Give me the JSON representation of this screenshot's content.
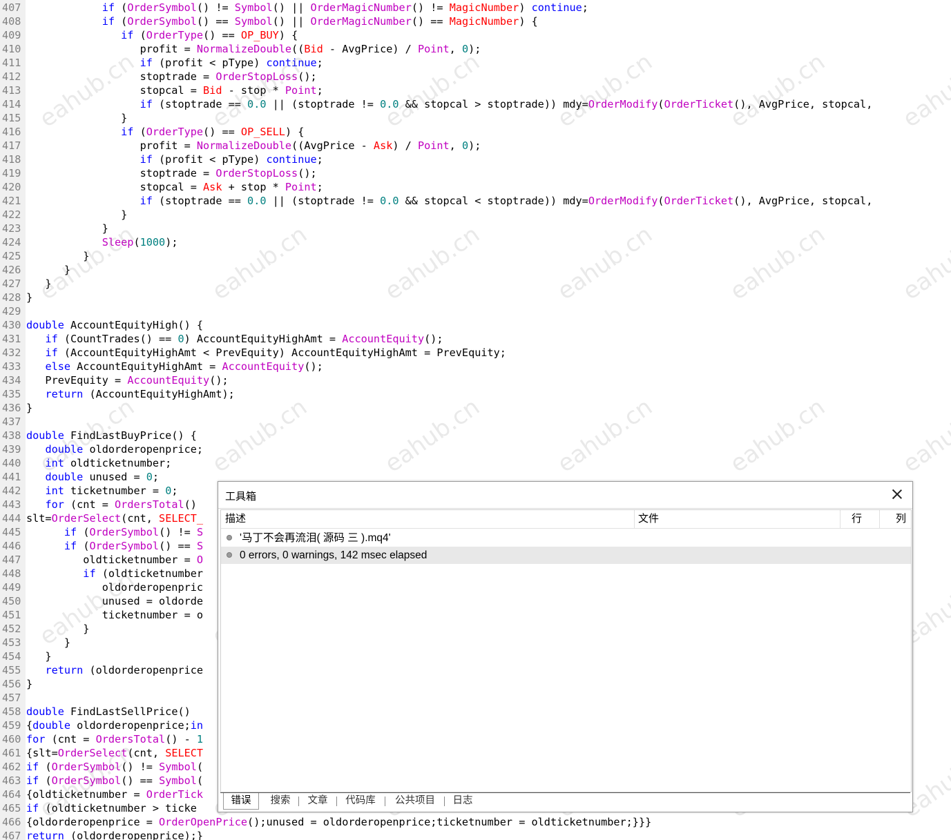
{
  "editor": {
    "lines": [
      {
        "n": "407",
        "c": [
          [
            "            ",
            ""
          ],
          [
            "if",
            "kw"
          ],
          [
            " (",
            ""
          ],
          [
            "OrderSymbol",
            "fn"
          ],
          [
            "() != ",
            ""
          ],
          [
            "Symbol",
            "fn"
          ],
          [
            "() || ",
            ""
          ],
          [
            "OrderMagicNumber",
            "fn"
          ],
          [
            "() != ",
            ""
          ],
          [
            "MagicNumber",
            "cn"
          ],
          [
            ") ",
            ""
          ],
          [
            "continue",
            "kw"
          ],
          [
            ";",
            ""
          ]
        ]
      },
      {
        "n": "408",
        "c": [
          [
            "            ",
            ""
          ],
          [
            "if",
            "kw"
          ],
          [
            " (",
            ""
          ],
          [
            "OrderSymbol",
            "fn"
          ],
          [
            "() == ",
            ""
          ],
          [
            "Symbol",
            "fn"
          ],
          [
            "() || ",
            ""
          ],
          [
            "OrderMagicNumber",
            "fn"
          ],
          [
            "() == ",
            ""
          ],
          [
            "MagicNumber",
            "cn"
          ],
          [
            ") {",
            ""
          ]
        ]
      },
      {
        "n": "409",
        "c": [
          [
            "               ",
            ""
          ],
          [
            "if",
            "kw"
          ],
          [
            " (",
            ""
          ],
          [
            "OrderType",
            "fn"
          ],
          [
            "() == ",
            ""
          ],
          [
            "OP_BUY",
            "cn"
          ],
          [
            ") {",
            ""
          ]
        ]
      },
      {
        "n": "410",
        "c": [
          [
            "                  profit = ",
            ""
          ],
          [
            "NormalizeDouble",
            "fn"
          ],
          [
            "((",
            ""
          ],
          [
            "Bid",
            "cn"
          ],
          [
            " - AvgPrice) / ",
            ""
          ],
          [
            "Point",
            "fn"
          ],
          [
            ", ",
            ""
          ],
          [
            "0",
            "nm"
          ],
          [
            ");",
            ""
          ]
        ]
      },
      {
        "n": "411",
        "c": [
          [
            "                  ",
            ""
          ],
          [
            "if",
            "kw"
          ],
          [
            " (profit < pType) ",
            ""
          ],
          [
            "continue",
            "kw"
          ],
          [
            ";",
            ""
          ]
        ]
      },
      {
        "n": "412",
        "c": [
          [
            "                  stoptrade = ",
            ""
          ],
          [
            "OrderStopLoss",
            "fn"
          ],
          [
            "();",
            ""
          ]
        ]
      },
      {
        "n": "413",
        "c": [
          [
            "                  stopcal = ",
            ""
          ],
          [
            "Bid",
            "cn"
          ],
          [
            " - stop * ",
            ""
          ],
          [
            "Point",
            "fn"
          ],
          [
            ";",
            ""
          ]
        ]
      },
      {
        "n": "414",
        "c": [
          [
            "                  ",
            ""
          ],
          [
            "if",
            "kw"
          ],
          [
            " (stoptrade == ",
            ""
          ],
          [
            "0.0",
            "nm"
          ],
          [
            " || (stoptrade != ",
            ""
          ],
          [
            "0.0",
            "nm"
          ],
          [
            " && stopcal > stoptrade)) mdy=",
            ""
          ],
          [
            "OrderModify",
            "fn"
          ],
          [
            "(",
            ""
          ],
          [
            "OrderTicket",
            "fn"
          ],
          [
            "(), AvgPrice, stopcal,",
            ""
          ]
        ]
      },
      {
        "n": "415",
        "c": [
          [
            "               }",
            ""
          ]
        ]
      },
      {
        "n": "416",
        "c": [
          [
            "               ",
            ""
          ],
          [
            "if",
            "kw"
          ],
          [
            " (",
            ""
          ],
          [
            "OrderType",
            "fn"
          ],
          [
            "() == ",
            ""
          ],
          [
            "OP_SELL",
            "cn"
          ],
          [
            ") {",
            ""
          ]
        ]
      },
      {
        "n": "417",
        "c": [
          [
            "                  profit = ",
            ""
          ],
          [
            "NormalizeDouble",
            "fn"
          ],
          [
            "((AvgPrice - ",
            ""
          ],
          [
            "Ask",
            "cn"
          ],
          [
            ") / ",
            ""
          ],
          [
            "Point",
            "fn"
          ],
          [
            ", ",
            ""
          ],
          [
            "0",
            "nm"
          ],
          [
            ");",
            ""
          ]
        ]
      },
      {
        "n": "418",
        "c": [
          [
            "                  ",
            ""
          ],
          [
            "if",
            "kw"
          ],
          [
            " (profit < pType) ",
            ""
          ],
          [
            "continue",
            "kw"
          ],
          [
            ";",
            ""
          ]
        ]
      },
      {
        "n": "419",
        "c": [
          [
            "                  stoptrade = ",
            ""
          ],
          [
            "OrderStopLoss",
            "fn"
          ],
          [
            "();",
            ""
          ]
        ]
      },
      {
        "n": "420",
        "c": [
          [
            "                  stopcal = ",
            ""
          ],
          [
            "Ask",
            "cn"
          ],
          [
            " + stop * ",
            ""
          ],
          [
            "Point",
            "fn"
          ],
          [
            ";",
            ""
          ]
        ]
      },
      {
        "n": "421",
        "c": [
          [
            "                  ",
            ""
          ],
          [
            "if",
            "kw"
          ],
          [
            " (stoptrade == ",
            ""
          ],
          [
            "0.0",
            "nm"
          ],
          [
            " || (stoptrade != ",
            ""
          ],
          [
            "0.0",
            "nm"
          ],
          [
            " && stopcal < stoptrade)) mdy=",
            ""
          ],
          [
            "OrderModify",
            "fn"
          ],
          [
            "(",
            ""
          ],
          [
            "OrderTicket",
            "fn"
          ],
          [
            "(), AvgPrice, stopcal,",
            ""
          ]
        ]
      },
      {
        "n": "422",
        "c": [
          [
            "               }",
            ""
          ]
        ]
      },
      {
        "n": "423",
        "c": [
          [
            "            }",
            ""
          ]
        ]
      },
      {
        "n": "424",
        "c": [
          [
            "            ",
            ""
          ],
          [
            "Sleep",
            "fn"
          ],
          [
            "(",
            ""
          ],
          [
            "1000",
            "nm"
          ],
          [
            ");",
            ""
          ]
        ]
      },
      {
        "n": "425",
        "c": [
          [
            "         }",
            ""
          ]
        ]
      },
      {
        "n": "426",
        "c": [
          [
            "      }",
            ""
          ]
        ]
      },
      {
        "n": "427",
        "c": [
          [
            "   }",
            ""
          ]
        ]
      },
      {
        "n": "428",
        "c": [
          [
            "}",
            ""
          ]
        ]
      },
      {
        "n": "429",
        "c": [
          [
            "",
            ""
          ]
        ]
      },
      {
        "n": "430",
        "c": [
          [
            "double",
            "kw"
          ],
          [
            " AccountEquityHigh() {",
            ""
          ]
        ]
      },
      {
        "n": "431",
        "c": [
          [
            "   ",
            ""
          ],
          [
            "if",
            "kw"
          ],
          [
            " (CountTrades() == ",
            ""
          ],
          [
            "0",
            "nm"
          ],
          [
            ") AccountEquityHighAmt = ",
            ""
          ],
          [
            "AccountEquity",
            "fn"
          ],
          [
            "();",
            ""
          ]
        ]
      },
      {
        "n": "432",
        "c": [
          [
            "   ",
            ""
          ],
          [
            "if",
            "kw"
          ],
          [
            " (AccountEquityHighAmt < PrevEquity) AccountEquityHighAmt = PrevEquity;",
            ""
          ]
        ]
      },
      {
        "n": "433",
        "c": [
          [
            "   ",
            ""
          ],
          [
            "else",
            "kw"
          ],
          [
            " AccountEquityHighAmt = ",
            ""
          ],
          [
            "AccountEquity",
            "fn"
          ],
          [
            "();",
            ""
          ]
        ]
      },
      {
        "n": "434",
        "c": [
          [
            "   PrevEquity = ",
            ""
          ],
          [
            "AccountEquity",
            "fn"
          ],
          [
            "();",
            ""
          ]
        ]
      },
      {
        "n": "435",
        "c": [
          [
            "   ",
            ""
          ],
          [
            "return",
            "kw"
          ],
          [
            " (AccountEquityHighAmt);",
            ""
          ]
        ]
      },
      {
        "n": "436",
        "c": [
          [
            "}",
            ""
          ]
        ]
      },
      {
        "n": "437",
        "c": [
          [
            "",
            ""
          ]
        ]
      },
      {
        "n": "438",
        "c": [
          [
            "double",
            "kw"
          ],
          [
            " FindLastBuyPrice() {",
            ""
          ]
        ]
      },
      {
        "n": "439",
        "c": [
          [
            "   ",
            ""
          ],
          [
            "double",
            "kw"
          ],
          [
            " oldorderopenprice;",
            ""
          ]
        ]
      },
      {
        "n": "440",
        "c": [
          [
            "   ",
            ""
          ],
          [
            "int",
            "kw"
          ],
          [
            " oldticketnumber;",
            ""
          ]
        ]
      },
      {
        "n": "441",
        "c": [
          [
            "   ",
            ""
          ],
          [
            "double",
            "kw"
          ],
          [
            " unused = ",
            ""
          ],
          [
            "0",
            "nm"
          ],
          [
            ";",
            ""
          ]
        ]
      },
      {
        "n": "442",
        "c": [
          [
            "   ",
            ""
          ],
          [
            "int",
            "kw"
          ],
          [
            " ticketnumber = ",
            ""
          ],
          [
            "0",
            "nm"
          ],
          [
            ";",
            ""
          ]
        ]
      },
      {
        "n": "443",
        "c": [
          [
            "   ",
            ""
          ],
          [
            "for",
            "kw"
          ],
          [
            " (cnt = ",
            ""
          ],
          [
            "OrdersTotal",
            "fn"
          ],
          [
            "()",
            ""
          ]
        ]
      },
      {
        "n": "444",
        "c": [
          [
            "slt=",
            ""
          ],
          [
            "OrderSelect",
            "fn"
          ],
          [
            "(cnt, ",
            ""
          ],
          [
            "SELECT_",
            "cn"
          ]
        ]
      },
      {
        "n": "445",
        "c": [
          [
            "      ",
            ""
          ],
          [
            "if",
            "kw"
          ],
          [
            " (",
            ""
          ],
          [
            "OrderSymbol",
            "fn"
          ],
          [
            "() != ",
            ""
          ],
          [
            "S",
            "fn"
          ]
        ]
      },
      {
        "n": "446",
        "c": [
          [
            "      ",
            ""
          ],
          [
            "if",
            "kw"
          ],
          [
            " (",
            ""
          ],
          [
            "OrderSymbol",
            "fn"
          ],
          [
            "() == ",
            ""
          ],
          [
            "S",
            "fn"
          ]
        ]
      },
      {
        "n": "447",
        "c": [
          [
            "         oldticketnumber = ",
            ""
          ],
          [
            "O",
            "fn"
          ]
        ]
      },
      {
        "n": "448",
        "c": [
          [
            "         ",
            ""
          ],
          [
            "if",
            "kw"
          ],
          [
            " (oldticketnumber",
            ""
          ]
        ]
      },
      {
        "n": "449",
        "c": [
          [
            "            oldorderopenpric",
            ""
          ]
        ]
      },
      {
        "n": "450",
        "c": [
          [
            "            unused = oldorde",
            ""
          ]
        ]
      },
      {
        "n": "451",
        "c": [
          [
            "            ticketnumber = o",
            ""
          ]
        ]
      },
      {
        "n": "452",
        "c": [
          [
            "         }",
            ""
          ]
        ]
      },
      {
        "n": "453",
        "c": [
          [
            "      }",
            ""
          ]
        ]
      },
      {
        "n": "454",
        "c": [
          [
            "   }",
            ""
          ]
        ]
      },
      {
        "n": "455",
        "c": [
          [
            "   ",
            ""
          ],
          [
            "return",
            "kw"
          ],
          [
            " (oldorderopenprice",
            ""
          ]
        ]
      },
      {
        "n": "456",
        "c": [
          [
            "}",
            ""
          ]
        ]
      },
      {
        "n": "457",
        "c": [
          [
            "",
            ""
          ]
        ]
      },
      {
        "n": "458",
        "c": [
          [
            "double",
            "kw"
          ],
          [
            " FindLastSellPrice()",
            ""
          ]
        ]
      },
      {
        "n": "459",
        "c": [
          [
            "{",
            ""
          ],
          [
            "double",
            "kw"
          ],
          [
            " oldorderopenprice;",
            ""
          ],
          [
            "in",
            "kw"
          ]
        ]
      },
      {
        "n": "460",
        "c": [
          [
            "for",
            "kw"
          ],
          [
            " (cnt = ",
            ""
          ],
          [
            "OrdersTotal",
            "fn"
          ],
          [
            "() - ",
            ""
          ],
          [
            "1",
            "nm"
          ]
        ]
      },
      {
        "n": "461",
        "c": [
          [
            "{slt=",
            ""
          ],
          [
            "OrderSelect",
            "fn"
          ],
          [
            "(cnt, ",
            ""
          ],
          [
            "SELECT",
            "cn"
          ]
        ]
      },
      {
        "n": "462",
        "c": [
          [
            "if",
            "kw"
          ],
          [
            " (",
            ""
          ],
          [
            "OrderSymbol",
            "fn"
          ],
          [
            "() != ",
            ""
          ],
          [
            "Symbol",
            "fn"
          ],
          [
            "(",
            ""
          ]
        ]
      },
      {
        "n": "463",
        "c": [
          [
            "if",
            "kw"
          ],
          [
            " (",
            ""
          ],
          [
            "OrderSymbol",
            "fn"
          ],
          [
            "() == ",
            ""
          ],
          [
            "Symbol",
            "fn"
          ],
          [
            "(",
            ""
          ]
        ]
      },
      {
        "n": "464",
        "c": [
          [
            "{oldticketnumber = ",
            ""
          ],
          [
            "OrderTick",
            "fn"
          ]
        ]
      },
      {
        "n": "465",
        "c": [
          [
            "if",
            "kw"
          ],
          [
            " (oldticketnumber > ticke",
            ""
          ]
        ]
      },
      {
        "n": "466",
        "c": [
          [
            "{oldorderopenprice = ",
            ""
          ],
          [
            "OrderOpenPrice",
            "fn"
          ],
          [
            "();unused = oldorderopenprice;ticketnumber = oldticketnumber;}}}",
            ""
          ]
        ]
      },
      {
        "n": "467",
        "c": [
          [
            "return",
            "kw"
          ],
          [
            " (oldorderopenprice);}",
            ""
          ]
        ]
      }
    ]
  },
  "watermark": "eahub.cn",
  "toolbox": {
    "title": "工具箱",
    "columns": {
      "desc": "描述",
      "file": "文件",
      "line": "行",
      "col": "列"
    },
    "rows": [
      {
        "text": "'马丁不会再流泪( 源码 三 ).mq4'",
        "selected": false
      },
      {
        "text": "0 errors, 0 warnings, 142 msec elapsed",
        "selected": true
      }
    ],
    "tabs": [
      "错误",
      "搜索",
      "文章",
      "代码库",
      "公共项目",
      "日志"
    ],
    "active_tab": "错误"
  }
}
